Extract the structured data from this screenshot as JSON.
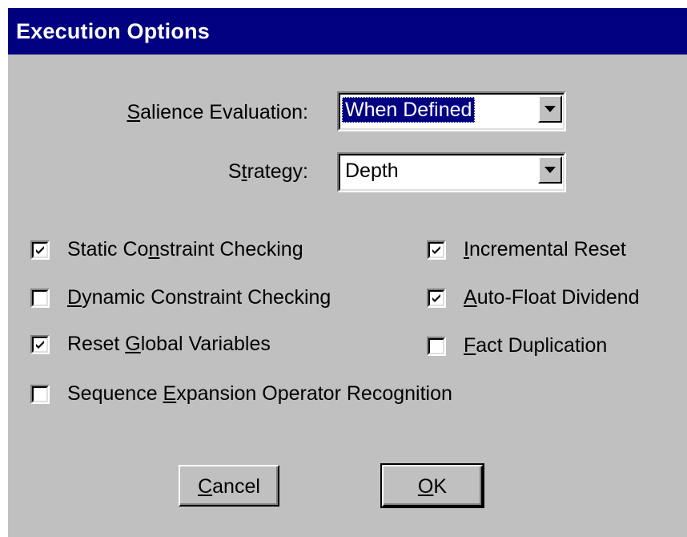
{
  "dialog": {
    "title": "Execution Options"
  },
  "salience": {
    "label_pre": "",
    "label_mnemonic": "S",
    "label_post": "alience Evaluation:",
    "value": "When Defined"
  },
  "strategy": {
    "label_pre": "S",
    "label_mnemonic": "t",
    "label_post": "rategy:",
    "value": "Depth"
  },
  "checkboxes": {
    "static_constraint": {
      "pre": "Static Co",
      "mnemonic": "n",
      "post": "straint Checking",
      "checked": true
    },
    "dynamic_constraint": {
      "pre": "",
      "mnemonic": "D",
      "post": "ynamic Constraint Checking",
      "checked": false
    },
    "reset_globals": {
      "pre": "Reset ",
      "mnemonic": "G",
      "post": "lobal Variables",
      "checked": true
    },
    "sequence_expansion": {
      "pre": "Sequence ",
      "mnemonic": "E",
      "post": "xpansion Operator Recognition",
      "checked": false
    },
    "incremental_reset": {
      "pre": "",
      "mnemonic": "I",
      "post": "ncremental Reset",
      "checked": true
    },
    "auto_float": {
      "pre": "",
      "mnemonic": "A",
      "post": "uto-Float Dividend",
      "checked": true
    },
    "fact_duplication": {
      "pre": "",
      "mnemonic": "F",
      "post": "act Duplication",
      "checked": false
    }
  },
  "buttons": {
    "cancel": {
      "pre": "",
      "mnemonic": "C",
      "post": "ancel"
    },
    "ok": {
      "pre": "",
      "mnemonic": "O",
      "post": "K"
    }
  },
  "icons": {
    "dropdown": "chevron-down-icon",
    "check": "checkmark-icon"
  },
  "colors": {
    "title_bg": "#000080",
    "face": "#c0c0c0",
    "selection": "#000080"
  }
}
